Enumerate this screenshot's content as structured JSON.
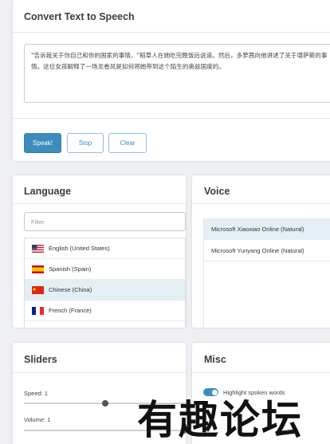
{
  "tts": {
    "title": "Convert Text to Speech",
    "text": "\"告诉我关于你自己和你的国家的事情。\"稻草人在她吃完晚饭后说道。然后，多萝茜向他讲述了关于堪萨斯的事情。这位女孩解释了一场龙卷风是如何将她带到这个陌生的奥兹国度的。",
    "buttons": {
      "speak": "Speak!",
      "stop": "Stop",
      "clear": "Clear"
    }
  },
  "language": {
    "title": "Language",
    "filter_placeholder": "Filter",
    "items": [
      {
        "label": "English (United States)",
        "flag": "us-flag-icon"
      },
      {
        "label": "Spanish (Spain)",
        "flag": "spain-flag-icon"
      },
      {
        "label": "Chinese (China)",
        "flag": "china-flag-icon",
        "selected": true
      },
      {
        "label": "French (France)",
        "flag": "france-flag-icon"
      }
    ]
  },
  "voice": {
    "title": "Voice",
    "items": [
      {
        "label": "Microsoft Xiaoxiao Online (Natural)",
        "selected": true
      },
      {
        "label": "Microsoft Yunyang Online (Natural)"
      }
    ]
  },
  "sliders": {
    "title": "Sliders",
    "speed_label": "Speed: 1",
    "volume_label": "Volume: 1",
    "speed_value": 1,
    "volume_value": 1
  },
  "misc": {
    "title": "Misc",
    "highlight_label": "Highlight spoken words",
    "highlight_on": true
  },
  "watermark": {
    "text": "有趣论坛"
  },
  "colors": {
    "accent": "#3c8dbc",
    "selected_row": "#e4eef5"
  }
}
